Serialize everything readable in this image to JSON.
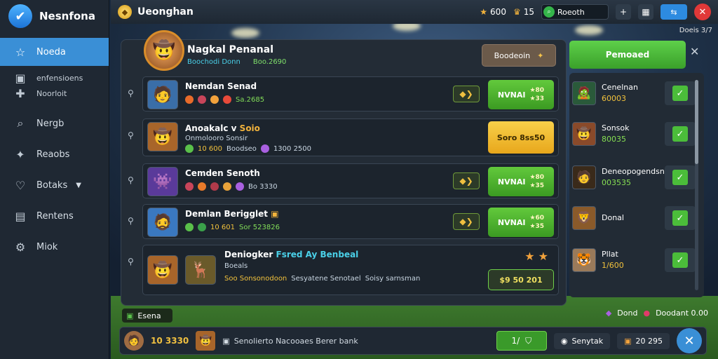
{
  "sidebar": {
    "title": "Nesnfona",
    "items": [
      {
        "label": "Noeda",
        "icon": "star-icon"
      },
      {
        "label": "enfensioens",
        "icon": "chat-icon",
        "sub": true
      },
      {
        "label": "Noorloit",
        "icon": "plus-icon",
        "sub": true
      },
      {
        "label": "Nergb",
        "icon": "search-icon"
      },
      {
        "label": "Reaobs",
        "icon": "puzzle-icon"
      },
      {
        "label": "Botaks",
        "icon": "trophy-icon",
        "chevron": "▼"
      },
      {
        "label": "Rentens",
        "icon": "box-icon"
      },
      {
        "label": "Miok",
        "icon": "gear-icon"
      }
    ]
  },
  "topbar": {
    "title": "Ueonghan",
    "stat1": "600",
    "stat2": "15",
    "search_value": "Roeoth",
    "version": "Doeis 3/7"
  },
  "panel": {
    "player_name": "Nagkal Penanal",
    "player_sub1": "Boochodi Donn",
    "player_sub2": "Boo.2690",
    "gold_button": "Boodeoin"
  },
  "rows": [
    {
      "name": "Nemdan Senad",
      "stats": "Sa.2685",
      "btn_label": "NVNAI",
      "btn_values": [
        "80",
        "33"
      ],
      "emoji": "🧑"
    },
    {
      "name": "Anoakalc v",
      "name_hl": "Soio",
      "sub": "Onmolooro Sonsir",
      "stats1": "10 600",
      "stats2": "Boodseo",
      "stats3": "1300 2500",
      "btn_label": "Soro 8ss50",
      "emoji": "🤠"
    },
    {
      "name": "Cemden Senoth",
      "stats": "Bo 3330",
      "btn_label": "NVNAI",
      "btn_values": [
        "80",
        "35"
      ],
      "emoji": "👾"
    },
    {
      "name": "Demlan Berigglet",
      "stats1": "10 601",
      "stats2": "Sor 523826",
      "btn_label": "NVNAI",
      "btn_values": [
        "60",
        "35"
      ],
      "emoji": "🧔"
    },
    {
      "name": "Deniogker",
      "name_bl": "Fsred Ay Benbeal",
      "sub": "Boeals",
      "stats1": "Soo Sonsonodoon",
      "stats2": "Sesyatene Senotael",
      "stats3": "Soisy sarnsman",
      "btn_label": "$9 50 201",
      "emoji": "🤠",
      "emoji2": "🦌"
    }
  ],
  "right_list": [
    {
      "name": "Cenelnan",
      "value": "60003",
      "emoji": "🧟"
    },
    {
      "name": "Sonsok",
      "value": "80035",
      "emoji": "🤠"
    },
    {
      "name": "Deneopogendsn",
      "value": "003535",
      "emoji": "🧑"
    },
    {
      "name": "Donal",
      "value": "",
      "emoji": "🦁"
    },
    {
      "name": "Pllat",
      "value": "1/600",
      "emoji": "🐯"
    }
  ],
  "promo_button": "Pemoaed",
  "bottom_tag": "Esena",
  "bottom_right_tag1": "Dond",
  "bottom_right_tag2": "Doodant 0.00",
  "bottom": {
    "score": "10 3330",
    "message": "Senolierto Nacooaes Berer bank",
    "green_btn": "1/",
    "sort_label": "Senytak",
    "count": "20 295"
  }
}
